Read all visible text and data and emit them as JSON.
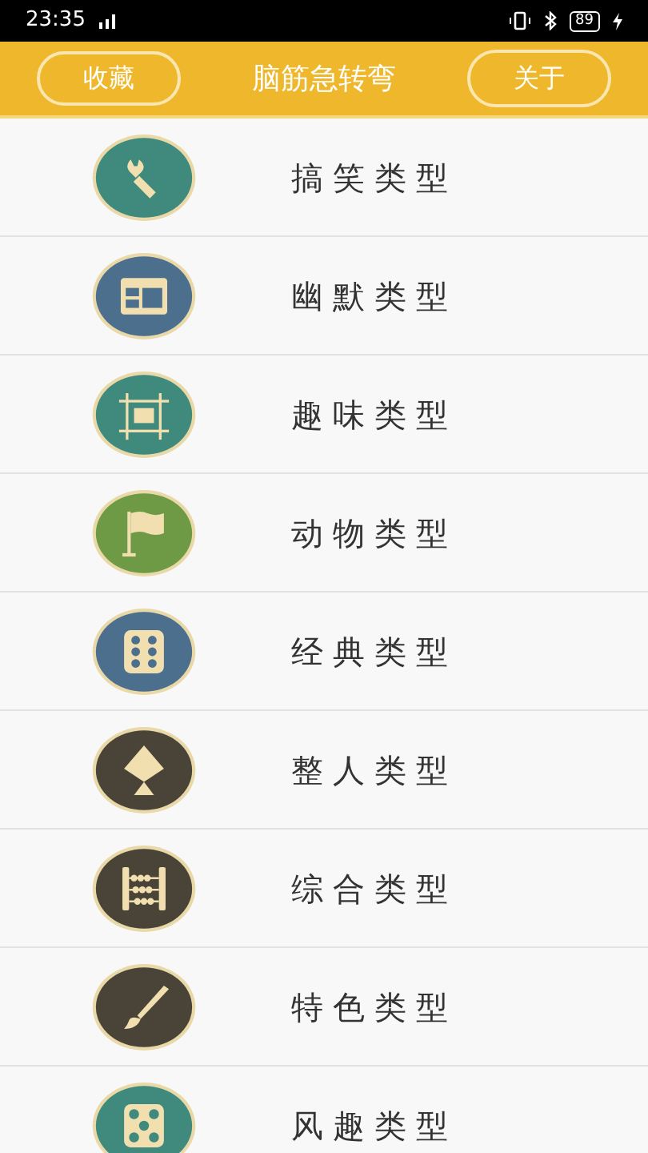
{
  "status_bar": {
    "time": "23:35",
    "battery": "89"
  },
  "header": {
    "left_button": "收藏",
    "title": "脑筋急转弯",
    "right_button": "关于"
  },
  "categories": [
    {
      "label": "搞笑类型",
      "kind": "wrench",
      "color": "#3f8a7c"
    },
    {
      "label": "幽默类型",
      "kind": "window",
      "color": "#4b6f8c"
    },
    {
      "label": "趣味类型",
      "kind": "frame",
      "color": "#3f8a7c"
    },
    {
      "label": "动物类型",
      "kind": "flag",
      "color": "#6e9a46"
    },
    {
      "label": "经典类型",
      "kind": "dice6",
      "color": "#4b6f8c"
    },
    {
      "label": "整人类型",
      "kind": "kite",
      "color": "#4a4438"
    },
    {
      "label": "综合类型",
      "kind": "abacus",
      "color": "#4a4438"
    },
    {
      "label": "特色类型",
      "kind": "brush",
      "color": "#4a4438"
    },
    {
      "label": "风趣类型",
      "kind": "dice5",
      "color": "#3f8a7c"
    }
  ]
}
